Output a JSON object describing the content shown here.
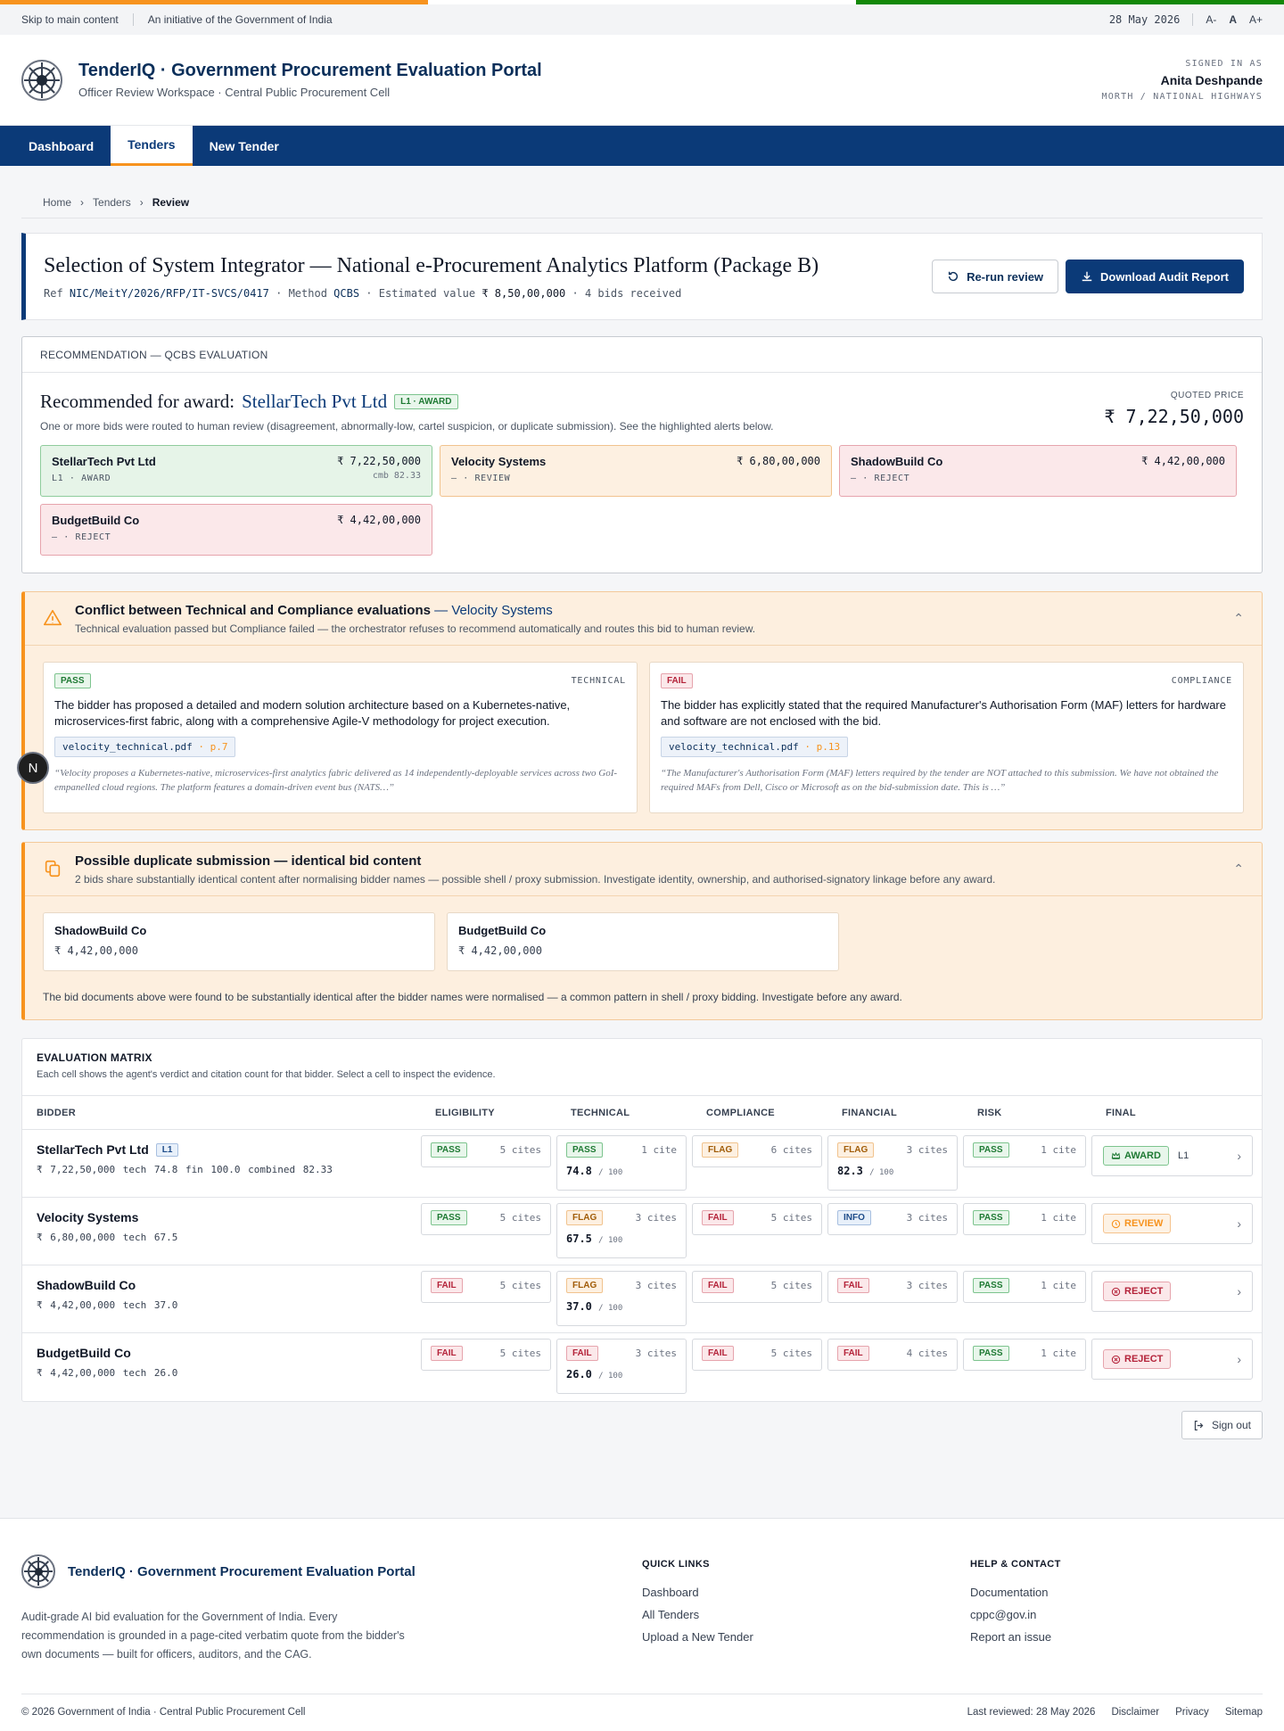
{
  "utility": {
    "skip": "Skip to main content",
    "initiative": "An initiative of the Government of India",
    "date": "28 May 2026",
    "font_small": "A-",
    "font_normal": "A",
    "font_large": "A+"
  },
  "header": {
    "title": "TenderIQ · Government Procurement Evaluation Portal",
    "subtitle": "Officer Review Workspace · Central Public Procurement Cell",
    "signed_in_label": "SIGNED IN AS",
    "user": "Anita Deshpande",
    "role": "MORTH / NATIONAL HIGHWAYS"
  },
  "nav": [
    {
      "label": "Dashboard"
    },
    {
      "label": "Tenders"
    },
    {
      "label": "New Tender"
    }
  ],
  "breadcrumb": [
    "Home",
    "Tenders",
    "Review"
  ],
  "tender": {
    "title": "Selection of System Integrator — National e-Procurement Analytics Platform (Package B)",
    "ref_label": "Ref",
    "ref": "NIC/MeitY/2026/RFP/IT-SVCS/0417",
    "method_label": "· Method",
    "method": "QCBS",
    "value_label": "· Estimated value",
    "value": "₹ 8,50,00,000",
    "bids": "· 4 bids received",
    "rerun": "Re-run review",
    "download": "Download Audit Report"
  },
  "recommendation": {
    "header": "RECOMMENDATION — QCBS EVALUATION",
    "prefix": "Recommended for award:",
    "winner": "StellarTech Pvt Ltd",
    "badge": "L1 · AWARD",
    "note": "One or more bids were routed to human review (disagreement, abnormally-low, cartel suspicion, or duplicate submission). See the highlighted alerts below.",
    "quoted_label": "QUOTED PRICE",
    "quoted": "₹ 7,22,50,000",
    "bids": [
      {
        "name": "StellarTech Pvt Ltd",
        "status": "L1 · AWARD",
        "price": "₹ 7,22,50,000",
        "cmb": "cmb 82.33",
        "kind": "award"
      },
      {
        "name": "Velocity Systems",
        "status": "— · REVIEW",
        "price": "₹ 6,80,00,000",
        "cmb": "",
        "kind": "review"
      },
      {
        "name": "ShadowBuild Co",
        "status": "— · REJECT",
        "price": "₹ 4,42,00,000",
        "cmb": "",
        "kind": "reject"
      },
      {
        "name": "BudgetBuild Co",
        "status": "— · REJECT",
        "price": "₹ 4,42,00,000",
        "cmb": "",
        "kind": "reject"
      }
    ]
  },
  "conflict": {
    "title": "Conflict between Technical and Compliance evaluations",
    "sep": "—",
    "bidder": "Velocity Systems",
    "subtitle": "Technical evaluation passed but Compliance failed — the orchestrator refuses to recommend automatically and routes this bid to human review.",
    "left": {
      "verdict": "PASS",
      "kind": "TECHNICAL",
      "text": "The bidder has proposed a detailed and modern solution architecture based on a Kubernetes-native, microservices-first fabric, along with a comprehensive Agile-V methodology for project execution.",
      "file": "velocity_technical.pdf",
      "page": "· p.7",
      "quote": "“Velocity proposes a Kubernetes-native, microservices-first analytics fabric delivered as 14 independently-deployable services across two GoI-empanelled cloud regions. The platform features a domain-driven event bus (NATS…”"
    },
    "right": {
      "verdict": "FAIL",
      "kind": "COMPLIANCE",
      "text": "The bidder has explicitly stated that the required Manufacturer's Authorisation Form (MAF) letters for hardware and software are not enclosed with the bid.",
      "file": "velocity_technical.pdf",
      "page": "· p.13",
      "quote": "“The Manufacturer's Authorisation Form (MAF) letters required by the tender are NOT attached to this submission. We have not obtained the required MAFs from Dell, Cisco or Microsoft as on the bid-submission date. This is …”"
    }
  },
  "duplicate": {
    "title": "Possible duplicate submission — identical bid content",
    "subtitle": "2 bids share substantially identical content after normalising bidder names — possible shell / proxy submission. Investigate identity, ownership, and authorised-signatory linkage before any award.",
    "bids": [
      {
        "name": "ShadowBuild Co",
        "price": "₹ 4,42,00,000"
      },
      {
        "name": "BudgetBuild Co",
        "price": "₹ 4,42,00,000"
      }
    ],
    "note": "The bid documents above were found to be substantially identical after the bidder names were normalised — a common pattern in shell / proxy bidding. Investigate before any award."
  },
  "matrix": {
    "title": "EVALUATION MATRIX",
    "subtitle": "Each cell shows the agent's verdict and citation count for that bidder. Select a cell to inspect the evidence.",
    "columns": [
      "BIDDER",
      "ELIGIBILITY",
      "TECHNICAL",
      "COMPLIANCE",
      "FINANCIAL",
      "RISK",
      "FINAL"
    ],
    "rows": [
      {
        "name": "StellarTech Pvt Ltd",
        "badge": "L1",
        "meta": "₹ 7,22,50,000  tech 74.8  fin 100.0  combined 82.33",
        "eligibility": {
          "v": "PASS",
          "c": "5 cites"
        },
        "technical": {
          "v": "PASS",
          "c": "1 cite",
          "score": "74.8",
          "of": "/ 100"
        },
        "compliance": {
          "v": "FLAG",
          "c": "6 cites"
        },
        "financial": {
          "v": "FLAG",
          "c": "3 cites",
          "score": "82.3",
          "of": "/ 100"
        },
        "risk": {
          "v": "PASS",
          "c": "1 cite"
        },
        "final": {
          "v": "AWARD",
          "extra": "L1"
        }
      },
      {
        "name": "Velocity Systems",
        "badge": "",
        "meta": "₹ 6,80,00,000  tech 67.5",
        "eligibility": {
          "v": "PASS",
          "c": "5 cites"
        },
        "technical": {
          "v": "FLAG",
          "c": "3 cites",
          "score": "67.5",
          "of": "/ 100"
        },
        "compliance": {
          "v": "FAIL",
          "c": "5 cites"
        },
        "financial": {
          "v": "INFO",
          "c": "3 cites"
        },
        "risk": {
          "v": "PASS",
          "c": "1 cite"
        },
        "final": {
          "v": "REVIEW",
          "extra": ""
        }
      },
      {
        "name": "ShadowBuild Co",
        "badge": "",
        "meta": "₹ 4,42,00,000  tech 37.0",
        "eligibility": {
          "v": "FAIL",
          "c": "5 cites"
        },
        "technical": {
          "v": "FLAG",
          "c": "3 cites",
          "score": "37.0",
          "of": "/ 100"
        },
        "compliance": {
          "v": "FAIL",
          "c": "5 cites"
        },
        "financial": {
          "v": "FAIL",
          "c": "3 cites"
        },
        "risk": {
          "v": "PASS",
          "c": "1 cite"
        },
        "final": {
          "v": "REJECT",
          "extra": ""
        }
      },
      {
        "name": "BudgetBuild Co",
        "badge": "",
        "meta": "₹ 4,42,00,000  tech 26.0",
        "eligibility": {
          "v": "FAIL",
          "c": "5 cites"
        },
        "technical": {
          "v": "FAIL",
          "c": "3 cites",
          "score": "26.0",
          "of": "/ 100"
        },
        "compliance": {
          "v": "FAIL",
          "c": "5 cites"
        },
        "financial": {
          "v": "FAIL",
          "c": "4 cites"
        },
        "risk": {
          "v": "PASS",
          "c": "1 cite"
        },
        "final": {
          "v": "REJECT",
          "extra": ""
        }
      }
    ]
  },
  "signout": "Sign out",
  "avatar": "N",
  "footer": {
    "title": "TenderIQ · Government Procurement Evaluation Portal",
    "desc": "Audit-grade AI bid evaluation for the Government of India. Every recommendation is grounded in a page-cited verbatim quote from the bidder's own documents — built for officers, auditors, and the CAG.",
    "quick_title": "QUICK LINKS",
    "quick": [
      "Dashboard",
      "All Tenders",
      "Upload a New Tender"
    ],
    "help_title": "HELP & CONTACT",
    "help": [
      "Documentation",
      "cppc@gov.in",
      "Report an issue"
    ],
    "copyright": "© 2026 Government of India · Central Public Procurement Cell",
    "reviewed": "Last reviewed: 28 May 2026",
    "links": [
      "Disclaimer",
      "Privacy",
      "Sitemap"
    ]
  },
  "colors": {
    "saffron": "#f7931e",
    "green": "#138808",
    "navy": "#0b3a78"
  }
}
